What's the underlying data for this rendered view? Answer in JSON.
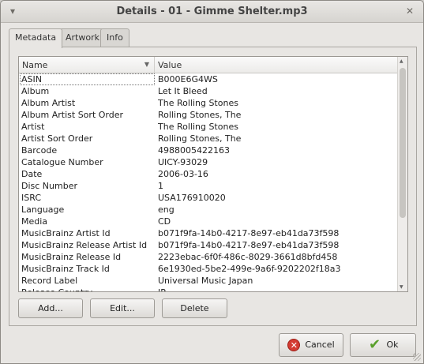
{
  "window": {
    "title": "Details - 01 - Gimme Shelter.mp3"
  },
  "tabs": [
    {
      "label": "Metadata"
    },
    {
      "label": "Artwork"
    },
    {
      "label": "Info"
    }
  ],
  "table": {
    "headers": {
      "name": "Name",
      "value": "Value"
    },
    "rows": [
      {
        "name": "ASIN",
        "value": "B000E6G4WS"
      },
      {
        "name": "Album",
        "value": "Let It Bleed"
      },
      {
        "name": "Album Artist",
        "value": "The Rolling Stones"
      },
      {
        "name": "Album Artist Sort Order",
        "value": "Rolling Stones, The"
      },
      {
        "name": "Artist",
        "value": "The Rolling Stones"
      },
      {
        "name": "Artist Sort Order",
        "value": "Rolling Stones, The"
      },
      {
        "name": "Barcode",
        "value": "4988005422163"
      },
      {
        "name": "Catalogue Number",
        "value": "UICY-93029"
      },
      {
        "name": "Date",
        "value": "2006-03-16"
      },
      {
        "name": "Disc Number",
        "value": "1"
      },
      {
        "name": "ISRC",
        "value": "USA176910020"
      },
      {
        "name": "Language",
        "value": "eng"
      },
      {
        "name": "Media",
        "value": "CD"
      },
      {
        "name": "MusicBrainz Artist Id",
        "value": "b071f9fa-14b0-4217-8e97-eb41da73f598"
      },
      {
        "name": "MusicBrainz Release Artist Id",
        "value": "b071f9fa-14b0-4217-8e97-eb41da73f598"
      },
      {
        "name": "MusicBrainz Release Id",
        "value": "2223ebac-6f0f-486c-8029-3661d8bfd458"
      },
      {
        "name": "MusicBrainz Track Id",
        "value": "6e1930ed-5be2-499e-9a6f-9202202f18a3"
      },
      {
        "name": "Record Label",
        "value": "Universal Music Japan"
      },
      {
        "name": "Release Country",
        "value": "JP"
      }
    ]
  },
  "buttons": {
    "add": "Add...",
    "edit": "Edit...",
    "delete": "Delete",
    "cancel": "Cancel",
    "ok": "Ok"
  },
  "icons": {
    "cancel": "cancel-icon",
    "ok": "checkmark-icon",
    "close": "close-icon",
    "minimize": "minimize-icon"
  }
}
